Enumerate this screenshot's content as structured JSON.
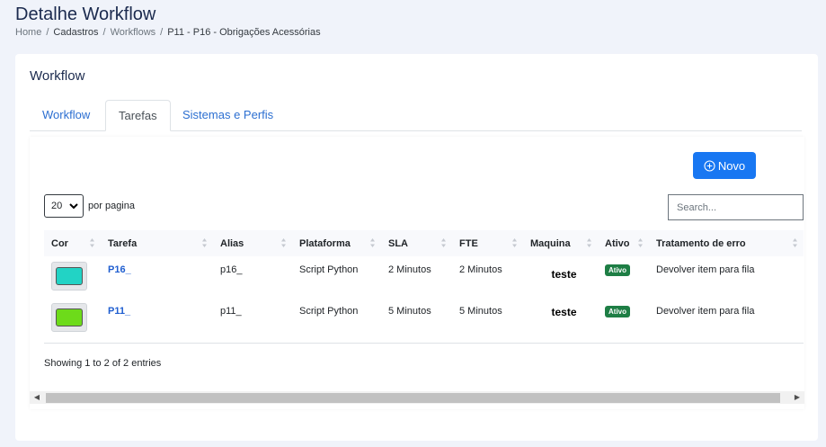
{
  "page": {
    "title": "Detalhe Workflow",
    "breadcrumb": [
      "Home",
      "Cadastros",
      "Workflows",
      "P11 - P16 - Obrigações Acessórias"
    ]
  },
  "card": {
    "title": "Workflow",
    "tabs": [
      {
        "label": "Workflow",
        "active": false
      },
      {
        "label": "Tarefas",
        "active": true
      },
      {
        "label": "Sistemas e Perfis",
        "active": false
      }
    ]
  },
  "toolbar": {
    "novo_label": "Novo",
    "accent": "#1877f2"
  },
  "length": {
    "value": "20",
    "suffix": "por pagina"
  },
  "search": {
    "placeholder": "Search..."
  },
  "table": {
    "headers": [
      "Cor",
      "Tarefa",
      "Alias",
      "Plataforma",
      "SLA",
      "FTE",
      "Maquina",
      "Ativo",
      "Tratamento de erro"
    ],
    "rows": [
      {
        "color": "#22d3c5",
        "tarefa": "P16_",
        "alias": "p16_",
        "plataforma": "Script Python",
        "sla": "2 Minutos",
        "fte": "2 Minutos",
        "maquina": "teste",
        "ativo": "Ativo",
        "tratamento": "Devolver item para fila"
      },
      {
        "color": "#6ddb1a",
        "tarefa": "P11_",
        "alias": "p11_",
        "plataforma": "Script Python",
        "sla": "5 Minutos",
        "fte": "5 Minutos",
        "maquina": "teste",
        "ativo": "Ativo",
        "tratamento": "Devolver item para fila"
      }
    ]
  },
  "info": "Showing 1 to 2 of 2 entries"
}
